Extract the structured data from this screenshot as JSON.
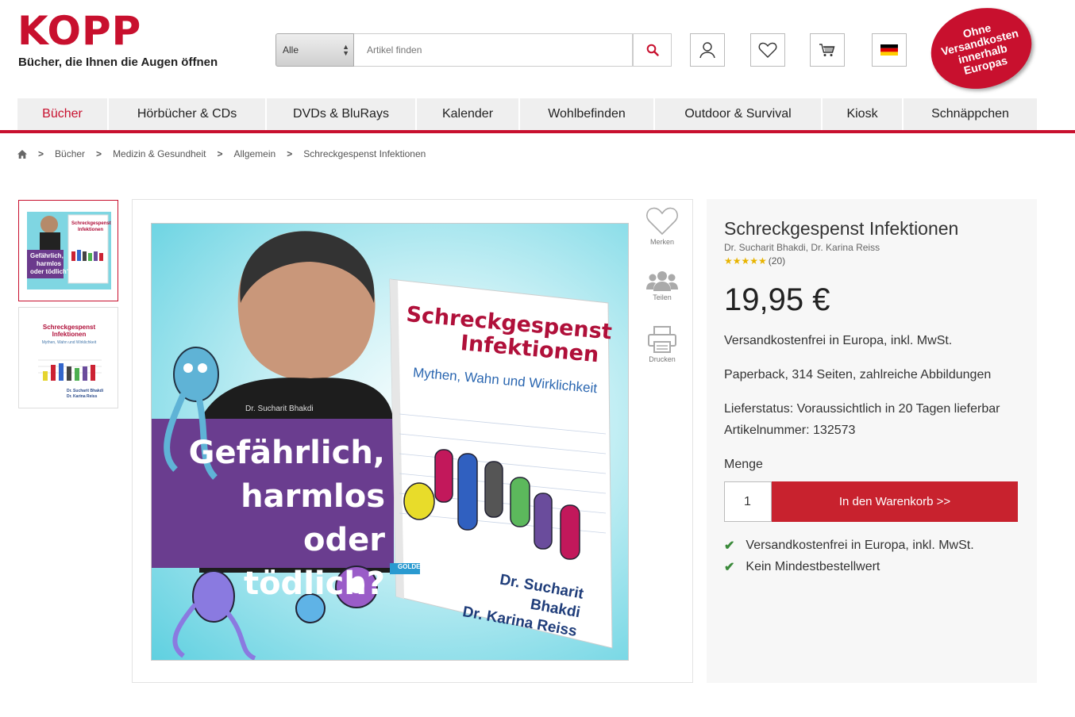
{
  "header": {
    "logo_text": "KOPP",
    "tagline": "Bücher, die Ihnen die Augen öffnen",
    "search": {
      "category": "Alle",
      "placeholder": "Artikel finden"
    },
    "icons": [
      "search-icon",
      "user-icon",
      "heart-icon",
      "cart-icon",
      "flag-de-icon"
    ],
    "badge_lines": [
      "Ohne",
      "Versandkosten",
      "innerhalb",
      "Europas"
    ]
  },
  "nav": {
    "items": [
      {
        "label": "Bücher",
        "active": true
      },
      {
        "label": "Hörbücher & CDs"
      },
      {
        "label": "DVDs & BluRays"
      },
      {
        "label": "Kalender"
      },
      {
        "label": "Wohlbefinden"
      },
      {
        "label": "Outdoor & Survival"
      },
      {
        "label": "Kiosk"
      },
      {
        "label": "Schnäppchen"
      }
    ]
  },
  "breadcrumb": [
    "Bücher",
    "Medizin & Gesundheit",
    "Allgemein",
    "Schreckgespenst Infektionen"
  ],
  "gallery": {
    "cover": {
      "book_title_1": "Schreckgespenst",
      "book_title_2": "Infektionen",
      "book_subtitle": "Mythen, Wahn und Wirklichkeit",
      "author_caption": "Dr. Sucharit Bhakdi",
      "headline_1": "Gefährlich,",
      "headline_2": "harmlos",
      "headline_3": "oder tödlich?",
      "book_author_1": "Dr. Sucharit Bhakdi",
      "book_author_2": "Dr. Karina Reiss",
      "publisher": "GOLDEGG"
    },
    "thumb2": {
      "title_1": "Schreckgespenst",
      "title_2": "Infektionen",
      "subtitle": "Mythen, Wahn und Wirklichkeit",
      "author_1": "Dr. Sucharit Bhakdi",
      "author_2": "Dr. Karina Reiss"
    },
    "actions": {
      "merken": "Merken",
      "teilen": "Teilen",
      "drucken": "Drucken"
    }
  },
  "product": {
    "title": "Schreckgespenst Infektionen",
    "authors": "Dr. Sucharit Bhakdi, Dr. Karina Reiss",
    "rating_stars": 5,
    "rating_count": "(20)",
    "price": "19,95 €",
    "shipping": "Versandkostenfrei in Europa, inkl. MwSt.",
    "format": "Paperback, 314 Seiten, zahlreiche Abbildungen",
    "delivery": "Lieferstatus: Voraussichtlich in 20 Tagen lieferbar",
    "article_no": "Artikelnummer: 132573",
    "qty_label": "Menge",
    "qty_value": "1",
    "cart_button": "In den Warenkorb >>",
    "benefits": [
      "Versandkostenfrei in Europa, inkl. MwSt.",
      "Kein Mindestbestellwert"
    ]
  },
  "colors": {
    "brand_red": "#c8102e",
    "star": "#e8b400",
    "check_green": "#3a8a3a"
  }
}
